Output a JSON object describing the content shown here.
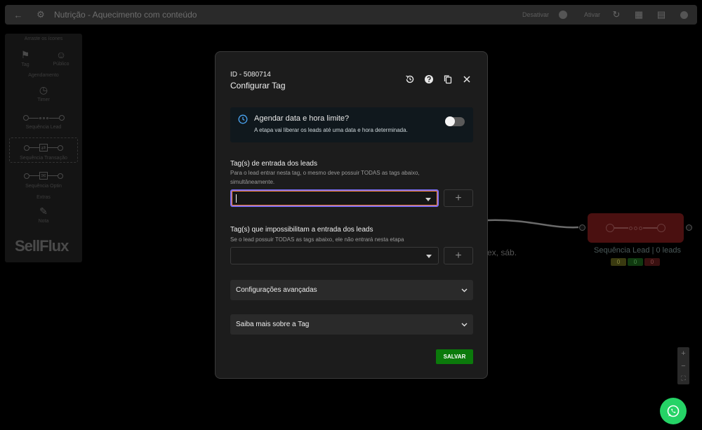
{
  "topbar": {
    "title": "Nutrição - Aquecimento com conteúdo",
    "desativar_label": "Desativar",
    "ativar_label": "Ativar"
  },
  "palette": {
    "section_top": "Arraste os ícones",
    "tag_label": "Tag",
    "publico_label": "Público",
    "section_agendamento": "Agendamento",
    "timer_label": "Timer",
    "seq_lead_label": "Sequência Lead",
    "seq_transacao_label": "Sequência Transação",
    "seq_optin_label": "Sequência Optin",
    "section_extras": "Extras",
    "nota_label": "Nota",
    "logo_text": "SellFlux"
  },
  "canvas": {
    "edge_label": "ex, sáb.",
    "seq_node_title": "Sequência Lead | 0 leads",
    "badges": [
      "0",
      "0",
      "0"
    ]
  },
  "modal": {
    "id_label": "ID - 5080714",
    "title": "Configurar Tag",
    "schedule": {
      "question": "Agendar data e hora limite?",
      "description": "A etapa vai liberar os leads até uma data e hora determinada.",
      "enabled": false
    },
    "entry_tags": {
      "title": "Tag(s) de entrada dos leads",
      "description": "Para o lead entrar nesta tag, o mesmo deve possuir TODAS as tags abaixo, simultâneamente.",
      "value": "",
      "add_label": "+"
    },
    "block_tags": {
      "title": "Tag(s) que impossibilitam a entrada dos leads",
      "description": "Se o lead possuir TODAS as tags abaixo, ele não entrará nesta etapa",
      "value": "",
      "add_label": "+"
    },
    "advanced_label": "Configurações avançadas",
    "learn_more_label": "Saiba mais sobre a Tag",
    "save_label": "SALVAR"
  },
  "colors": {
    "accent_green": "#0b7a0b",
    "focus_border": "#7c6cf0",
    "focus_inner": "#ff8a3d",
    "whatsapp": "#25d366"
  }
}
